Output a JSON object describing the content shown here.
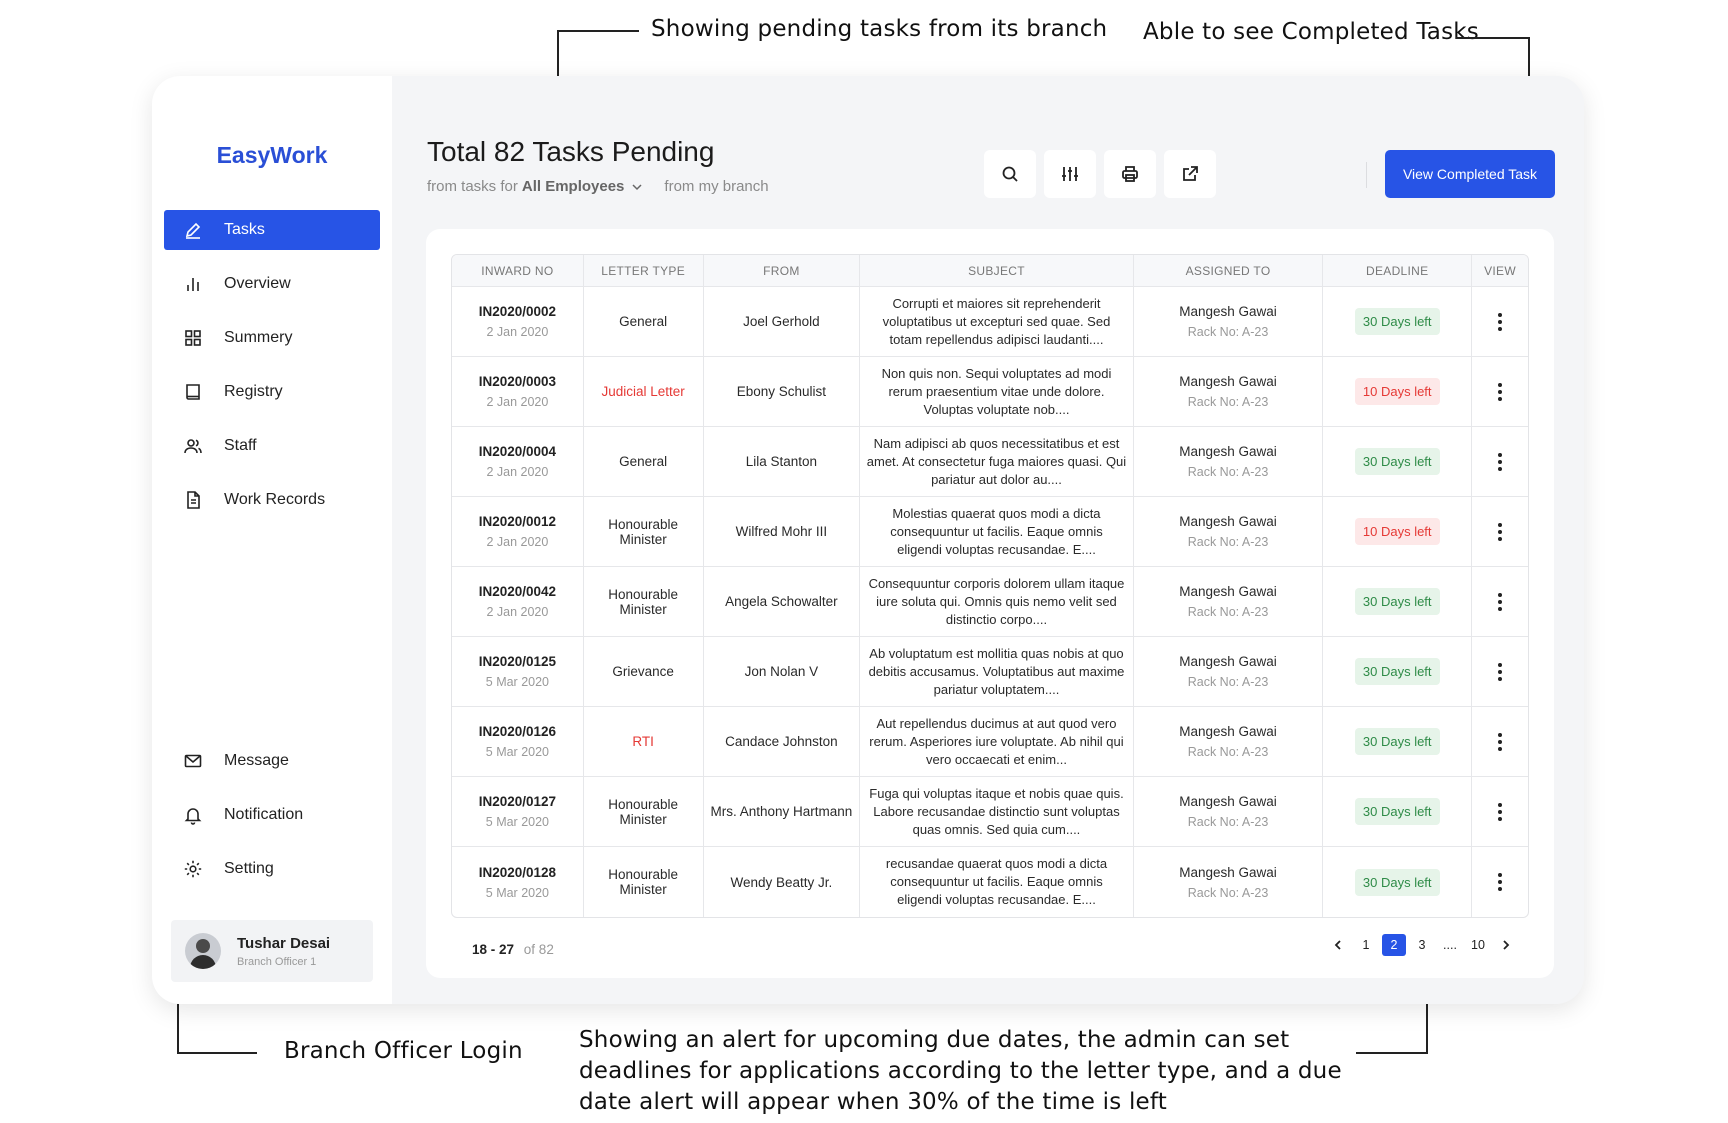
{
  "annotations": {
    "pending": "Showing pending tasks from its branch",
    "completed": "Able to see Completed Tasks",
    "login": "Branch Officer Login",
    "alert": "Showing an alert for upcoming due dates, the admin can set deadlines for applications according to the letter type, and a due date alert will appear when 30% of the time is left"
  },
  "app": {
    "logo": "EasyWork"
  },
  "sidebar": {
    "items": [
      {
        "label": "Tasks",
        "icon": "pen-icon"
      },
      {
        "label": "Overview",
        "icon": "bar-chart-icon"
      },
      {
        "label": "Summery",
        "icon": "grid-icon"
      },
      {
        "label": "Registry",
        "icon": "book-icon"
      },
      {
        "label": "Staff",
        "icon": "users-icon"
      },
      {
        "label": "Work Records",
        "icon": "document-icon"
      }
    ],
    "bottom_items": [
      {
        "label": "Message",
        "icon": "mail-icon"
      },
      {
        "label": "Notification",
        "icon": "bell-icon"
      },
      {
        "label": "Setting",
        "icon": "gear-icon"
      }
    ],
    "user": {
      "name": "Tushar Desai",
      "role": "Branch Officer 1"
    }
  },
  "header": {
    "title": "Total 82 Tasks Pending",
    "filter_prefix": "from tasks for",
    "filter_value": "All Employees",
    "filter_suffix": "from my branch",
    "primary_button": "View Completed Task"
  },
  "table": {
    "columns": [
      "INWARD NO",
      "LETTER TYPE",
      "FROM",
      "SUBJECT",
      "ASSIGNED TO",
      "DEADLINE",
      "VIEW"
    ],
    "rows": [
      {
        "inward": "IN2020/0002",
        "date": "2 Jan 2020",
        "letter_type": "General",
        "from": "Joel Gerhold",
        "subject": "Corrupti et maiores sit reprehenderit voluptatibus ut excepturi sed quae. Sed totam repellendus adipisci laudanti....",
        "assigned": "Mangesh Gawai",
        "rack": "Rack No: A-23",
        "deadline": "30 Days left"
      },
      {
        "inward": "IN2020/0003",
        "date": "2 Jan 2020",
        "letter_type": "Judicial Letter",
        "from": "Ebony Schulist",
        "subject": "Non quis non. Sequi voluptates ad modi rerum praesentium vitae unde dolore. Voluptas voluptate nob....",
        "assigned": "Mangesh Gawai",
        "rack": "Rack No: A-23",
        "deadline": "10 Days left"
      },
      {
        "inward": "IN2020/0004",
        "date": "2 Jan 2020",
        "letter_type": "General",
        "from": "Lila Stanton",
        "subject": "Nam adipisci ab quos necessitatibus et est amet. At consectetur fuga maiores quasi. Qui pariatur aut dolor au....",
        "assigned": "Mangesh Gawai",
        "rack": "Rack No: A-23",
        "deadline": "30 Days left"
      },
      {
        "inward": "IN2020/0012",
        "date": "2 Jan 2020",
        "letter_type": "Honourable Minister",
        "from": "Wilfred Mohr III",
        "subject": "Molestias quaerat quos modi a dicta consequuntur ut facilis. Eaque omnis eligendi voluptas recusandae. E....",
        "assigned": "Mangesh Gawai",
        "rack": "Rack No: A-23",
        "deadline": "10 Days left"
      },
      {
        "inward": "IN2020/0042",
        "date": "2 Jan 2020",
        "letter_type": "Honourable Minister",
        "from": "Angela Schowalter",
        "subject": "Consequuntur corporis dolorem ullam itaque iure soluta qui. Omnis quis nemo velit sed distinctio corpo....",
        "assigned": "Mangesh Gawai",
        "rack": "Rack No: A-23",
        "deadline": "30 Days left"
      },
      {
        "inward": "IN2020/0125",
        "date": "5 Mar 2020",
        "letter_type": "Grievance",
        "from": "Jon Nolan V",
        "subject": "Ab voluptatum est mollitia quas nobis at quo debitis accusamus. Voluptatibus aut maxime pariatur voluptatem....",
        "assigned": "Mangesh Gawai",
        "rack": "Rack No: A-23",
        "deadline": "30 Days left"
      },
      {
        "inward": "IN2020/0126",
        "date": "5 Mar 2020",
        "letter_type": "RTI",
        "from": "Candace Johnston",
        "subject": "Aut repellendus ducimus at aut quod vero rerum. Asperiores iure voluptate. Ab nihil qui vero occaecati et enim...",
        "assigned": "Mangesh Gawai",
        "rack": "Rack No: A-23",
        "deadline": "30 Days left"
      },
      {
        "inward": "IN2020/0127",
        "date": "5 Mar 2020",
        "letter_type": "Honourable Minister",
        "from": "Mrs. Anthony Hartmann",
        "subject": "Fuga qui voluptas itaque et nobis quae quis. Labore recusandae distinctio sunt voluptas quas omnis. Sed quia cum....",
        "assigned": "Mangesh Gawai",
        "rack": "Rack No: A-23",
        "deadline": "30 Days left"
      },
      {
        "inward": "IN2020/0128",
        "date": "5 Mar 2020",
        "letter_type": "Honourable Minister",
        "from": "Wendy Beatty Jr.",
        "subject": "recusandae quaerat quos modi a dicta consequuntur ut facilis. Eaque omnis eligendi voluptas recusandae. E....",
        "assigned": "Mangesh Gawai",
        "rack": "Rack No: A-23",
        "deadline": "30 Days left"
      }
    ]
  },
  "pagination": {
    "range": "18 - 27",
    "total": "of 82",
    "pages": [
      "1",
      "2",
      "3",
      "....",
      "10"
    ],
    "current": "2"
  },
  "colors": {
    "accent": "#2754e6",
    "logo": "#2a4fd6",
    "alert_red": "#e53935",
    "ok_green": "#2e8b47"
  }
}
